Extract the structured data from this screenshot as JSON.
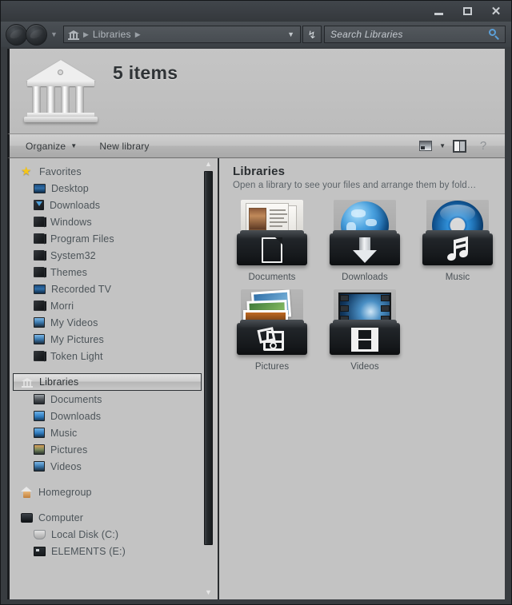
{
  "window": {
    "controls": {
      "minimize": "—",
      "maximize": "□",
      "close": "✕"
    }
  },
  "nav": {
    "back_icon": "back-circle-icon",
    "forward_icon": "forward-circle-icon",
    "history_caret": "▼",
    "breadcrumb_icon": "library-icon",
    "breadcrumb_root": "Libraries",
    "breadcrumb_sep": "▶",
    "address_chevron": "▼",
    "refresh_icon": "↯"
  },
  "search": {
    "placeholder": "Search Libraries",
    "icon": "search-icon"
  },
  "banner": {
    "icon": "library-building-icon",
    "title": "5 items"
  },
  "toolbar": {
    "organize_label": "Organize",
    "organize_caret": "▼",
    "new_library_label": "New library",
    "view_icon": "view-layout-icon",
    "view_caret": "▼",
    "preview_pane_icon": "preview-pane-icon",
    "help_icon": "?"
  },
  "sidebar": {
    "groups": [
      {
        "name": "favorites",
        "header": {
          "label": "Favorites",
          "icon": "star-icon",
          "level": "root"
        },
        "items": [
          {
            "label": "Desktop",
            "icon": "desktop-icon"
          },
          {
            "label": "Downloads",
            "icon": "downloads-folder-icon"
          },
          {
            "label": "Windows",
            "icon": "folder-icon"
          },
          {
            "label": "Program Files",
            "icon": "folder-icon"
          },
          {
            "label": "System32",
            "icon": "folder-icon"
          },
          {
            "label": "Themes",
            "icon": "folder-icon"
          },
          {
            "label": "Recorded TV",
            "icon": "tv-icon"
          },
          {
            "label": "Morri",
            "icon": "folder-icon"
          },
          {
            "label": "My Videos",
            "icon": "videos-folder-icon"
          },
          {
            "label": "My Pictures",
            "icon": "pictures-folder-icon"
          },
          {
            "label": "Token Light",
            "icon": "folder-icon"
          }
        ]
      },
      {
        "name": "libraries",
        "header": {
          "label": "Libraries",
          "icon": "library-icon",
          "level": "root",
          "selected": true
        },
        "items": [
          {
            "label": "Documents",
            "icon": "documents-library-icon"
          },
          {
            "label": "Downloads",
            "icon": "downloads-library-icon"
          },
          {
            "label": "Music",
            "icon": "music-library-icon"
          },
          {
            "label": "Pictures",
            "icon": "pictures-library-icon"
          },
          {
            "label": "Videos",
            "icon": "videos-library-icon"
          }
        ]
      },
      {
        "name": "homegroup",
        "header": {
          "label": "Homegroup",
          "icon": "homegroup-icon",
          "level": "root"
        },
        "items": []
      },
      {
        "name": "computer",
        "header": {
          "label": "Computer",
          "icon": "computer-icon",
          "level": "root"
        },
        "items": [
          {
            "label": "Local Disk (C:)",
            "icon": "disk-icon"
          },
          {
            "label": "ELEMENTS (E:)",
            "icon": "external-drive-icon"
          }
        ]
      }
    ],
    "scrollbar": {
      "up_arrow": "▲",
      "down_arrow": "▼"
    }
  },
  "content": {
    "title": "Libraries",
    "subtitle": "Open a library to see your files and arrange them by fold…",
    "tiles": [
      {
        "label": "Documents",
        "icon": "documents-library-tile"
      },
      {
        "label": "Downloads",
        "icon": "downloads-library-tile"
      },
      {
        "label": "Music",
        "icon": "music-library-tile"
      },
      {
        "label": "Pictures",
        "icon": "pictures-library-tile"
      },
      {
        "label": "Videos",
        "icon": "videos-library-tile"
      }
    ]
  },
  "colors": {
    "titlebar": "#3a3e43",
    "chrome": "#4a4f54",
    "pane_bg": "#c3c3c3",
    "text": "#4c5459",
    "accent_blue": "#5b9fd8",
    "star_yellow": "#f5c518"
  }
}
